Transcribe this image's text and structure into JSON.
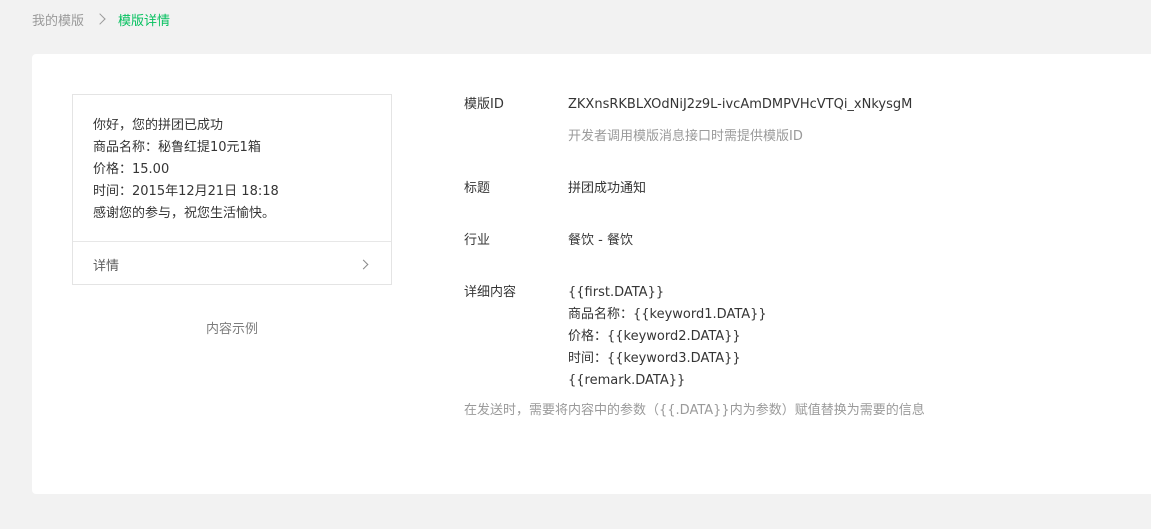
{
  "breadcrumb": {
    "parent": "我的模版",
    "current": "模版详情"
  },
  "preview": {
    "lines": [
      "你好，您的拼团已成功",
      "商品名称：秘鲁红提10元1箱",
      "价格：15.00",
      "时间：2015年12月21日 18:18",
      "感谢您的参与，祝您生活愉快。"
    ],
    "detail_label": "详情",
    "caption": "内容示例"
  },
  "info": {
    "template_id_label": "模版ID",
    "template_id_value": "ZKXnsRKBLXOdNiJ2z9L-ivcAmDMPVHcVTQi_xNkysgM",
    "template_id_hint": "开发者调用模版消息接口时需提供模版ID",
    "title_label": "标题",
    "title_value": "拼团成功通知",
    "industry_label": "行业",
    "industry_value": "餐饮 - 餐饮",
    "content_label": "详细内容",
    "content_lines": [
      "{{first.DATA}}",
      "商品名称：{{keyword1.DATA}}",
      "价格：{{keyword2.DATA}}",
      "时间：{{keyword3.DATA}}",
      "{{remark.DATA}}"
    ],
    "content_hint": "在发送时，需要将内容中的参数（{{.DATA}}内为参数）赋值替换为需要的信息"
  },
  "colors": {
    "accent": "#07c160",
    "background": "#f2f2f2",
    "card": "#ffffff",
    "text": "#353535",
    "muted": "#9a9a9a"
  }
}
